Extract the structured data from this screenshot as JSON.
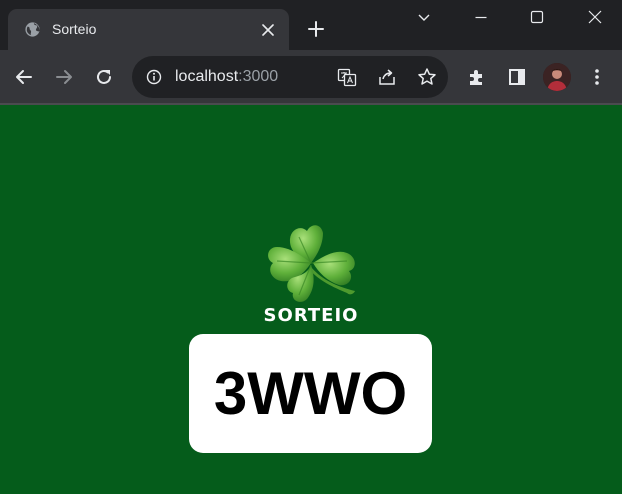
{
  "tab": {
    "title": "Sorteio",
    "favicon": "globe-icon"
  },
  "omnibox": {
    "host": "localhost",
    "port": ":3000"
  },
  "page": {
    "brand": "SORTEIO",
    "code": "3WWO"
  },
  "colors": {
    "page_bg": "#055c1b",
    "card_bg": "#ffffff",
    "tab_active": "#35363a",
    "frame": "#202124"
  }
}
